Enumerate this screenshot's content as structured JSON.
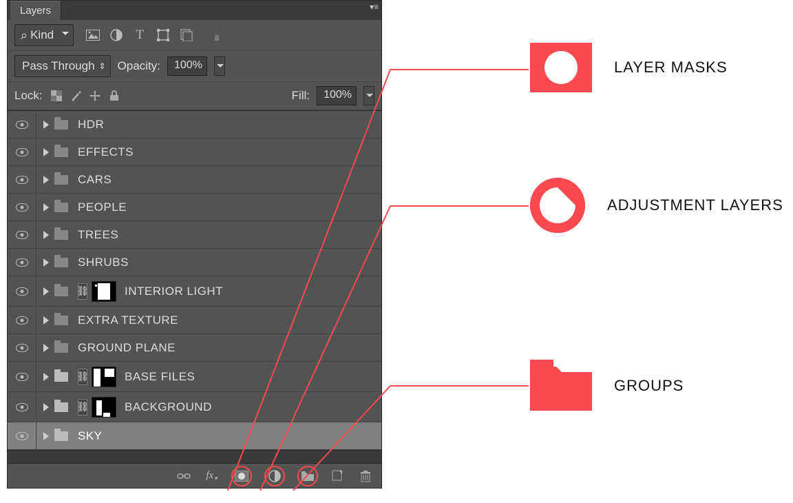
{
  "panel": {
    "title": "Layers",
    "filter_row": {
      "kind": "Kind",
      "icon_names": [
        "image-filter-icon",
        "adjustment-filter-icon",
        "type-filter-icon",
        "shape-filter-icon",
        "smart-filter-icon",
        "more-filter-icon"
      ]
    },
    "opacity_row": {
      "blend_mode": "Pass Through",
      "opacity_label": "Opacity:",
      "opacity_value": "100%"
    },
    "lock_row": {
      "lock_label": "Lock:",
      "fill_label": "Fill:",
      "fill_value": "100%",
      "lock_icons": [
        "lock-transparent-icon",
        "lock-pixels-icon",
        "lock-position-icon",
        "lock-all-icon"
      ]
    },
    "layers": [
      {
        "name": "HDR",
        "type": "group",
        "linked": false,
        "mask": false,
        "selected": false
      },
      {
        "name": "EFFECTS",
        "type": "group",
        "linked": false,
        "mask": false,
        "selected": false
      },
      {
        "name": "CARS",
        "type": "group",
        "linked": false,
        "mask": false,
        "selected": false
      },
      {
        "name": "PEOPLE",
        "type": "group",
        "linked": false,
        "mask": false,
        "selected": false
      },
      {
        "name": "TREES",
        "type": "group",
        "linked": false,
        "mask": false,
        "selected": false
      },
      {
        "name": "SHRUBS",
        "type": "group",
        "linked": false,
        "mask": false,
        "selected": false
      },
      {
        "name": "INTERIOR LIGHT",
        "type": "group",
        "linked": true,
        "mask": true,
        "selected": false
      },
      {
        "name": "EXTRA TEXTURE",
        "type": "group",
        "linked": false,
        "mask": false,
        "selected": false
      },
      {
        "name": "GROUND PLANE",
        "type": "group",
        "linked": false,
        "mask": false,
        "selected": false
      },
      {
        "name": "BASE FILES",
        "type": "group",
        "linked": true,
        "mask": true,
        "selected": false,
        "folder": "light"
      },
      {
        "name": "BACKGROUND",
        "type": "group",
        "linked": true,
        "mask": true,
        "selected": false,
        "folder": "light"
      },
      {
        "name": "SKY",
        "type": "group",
        "linked": false,
        "mask": false,
        "selected": true,
        "folder": "light"
      }
    ],
    "footer_icons": [
      "link-layers-icon",
      "fx-icon",
      "add-mask-icon",
      "add-adjustment-icon",
      "new-group-icon",
      "new-layer-icon",
      "delete-icon"
    ]
  },
  "callouts": {
    "layer_masks": "LAYER MASKS",
    "adjustment_layers": "ADJUSTMENT LAYERS",
    "groups": "GROUPS"
  },
  "colors": {
    "accent": "#fb4a4f",
    "panel_bg": "#535353"
  }
}
